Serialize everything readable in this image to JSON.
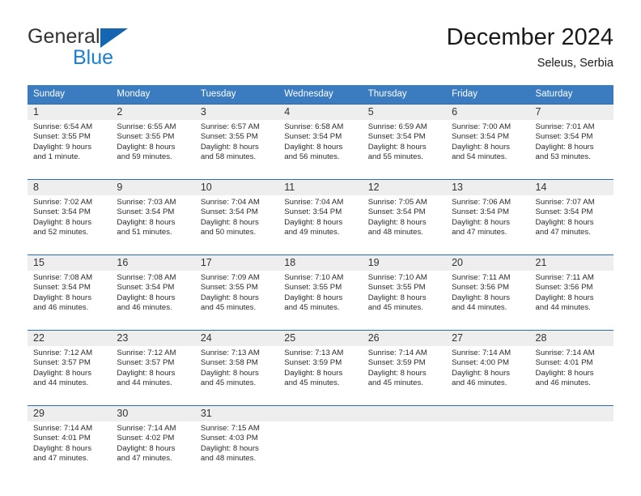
{
  "brand": {
    "name_part1": "General",
    "name_part2": "Blue",
    "logo_icon": "triangle-logo-icon"
  },
  "header": {
    "title": "December 2024",
    "subtitle": "Seleus, Serbia"
  },
  "colors": {
    "header_row_bg": "#3b7cc0",
    "cell_border": "#2c6cb0",
    "daynum_bg": "#eeeeee",
    "brand_blue": "#1a7fd4",
    "logo_blue": "#1566b0"
  },
  "weekday_headers": [
    "Sunday",
    "Monday",
    "Tuesday",
    "Wednesday",
    "Thursday",
    "Friday",
    "Saturday"
  ],
  "weeks": [
    [
      {
        "day": "1",
        "sunrise": "Sunrise: 6:54 AM",
        "sunset": "Sunset: 3:55 PM",
        "daylight1": "Daylight: 9 hours",
        "daylight2": "and 1 minute."
      },
      {
        "day": "2",
        "sunrise": "Sunrise: 6:55 AM",
        "sunset": "Sunset: 3:55 PM",
        "daylight1": "Daylight: 8 hours",
        "daylight2": "and 59 minutes."
      },
      {
        "day": "3",
        "sunrise": "Sunrise: 6:57 AM",
        "sunset": "Sunset: 3:55 PM",
        "daylight1": "Daylight: 8 hours",
        "daylight2": "and 58 minutes."
      },
      {
        "day": "4",
        "sunrise": "Sunrise: 6:58 AM",
        "sunset": "Sunset: 3:54 PM",
        "daylight1": "Daylight: 8 hours",
        "daylight2": "and 56 minutes."
      },
      {
        "day": "5",
        "sunrise": "Sunrise: 6:59 AM",
        "sunset": "Sunset: 3:54 PM",
        "daylight1": "Daylight: 8 hours",
        "daylight2": "and 55 minutes."
      },
      {
        "day": "6",
        "sunrise": "Sunrise: 7:00 AM",
        "sunset": "Sunset: 3:54 PM",
        "daylight1": "Daylight: 8 hours",
        "daylight2": "and 54 minutes."
      },
      {
        "day": "7",
        "sunrise": "Sunrise: 7:01 AM",
        "sunset": "Sunset: 3:54 PM",
        "daylight1": "Daylight: 8 hours",
        "daylight2": "and 53 minutes."
      }
    ],
    [
      {
        "day": "8",
        "sunrise": "Sunrise: 7:02 AM",
        "sunset": "Sunset: 3:54 PM",
        "daylight1": "Daylight: 8 hours",
        "daylight2": "and 52 minutes."
      },
      {
        "day": "9",
        "sunrise": "Sunrise: 7:03 AM",
        "sunset": "Sunset: 3:54 PM",
        "daylight1": "Daylight: 8 hours",
        "daylight2": "and 51 minutes."
      },
      {
        "day": "10",
        "sunrise": "Sunrise: 7:04 AM",
        "sunset": "Sunset: 3:54 PM",
        "daylight1": "Daylight: 8 hours",
        "daylight2": "and 50 minutes."
      },
      {
        "day": "11",
        "sunrise": "Sunrise: 7:04 AM",
        "sunset": "Sunset: 3:54 PM",
        "daylight1": "Daylight: 8 hours",
        "daylight2": "and 49 minutes."
      },
      {
        "day": "12",
        "sunrise": "Sunrise: 7:05 AM",
        "sunset": "Sunset: 3:54 PM",
        "daylight1": "Daylight: 8 hours",
        "daylight2": "and 48 minutes."
      },
      {
        "day": "13",
        "sunrise": "Sunrise: 7:06 AM",
        "sunset": "Sunset: 3:54 PM",
        "daylight1": "Daylight: 8 hours",
        "daylight2": "and 47 minutes."
      },
      {
        "day": "14",
        "sunrise": "Sunrise: 7:07 AM",
        "sunset": "Sunset: 3:54 PM",
        "daylight1": "Daylight: 8 hours",
        "daylight2": "and 47 minutes."
      }
    ],
    [
      {
        "day": "15",
        "sunrise": "Sunrise: 7:08 AM",
        "sunset": "Sunset: 3:54 PM",
        "daylight1": "Daylight: 8 hours",
        "daylight2": "and 46 minutes."
      },
      {
        "day": "16",
        "sunrise": "Sunrise: 7:08 AM",
        "sunset": "Sunset: 3:54 PM",
        "daylight1": "Daylight: 8 hours",
        "daylight2": "and 46 minutes."
      },
      {
        "day": "17",
        "sunrise": "Sunrise: 7:09 AM",
        "sunset": "Sunset: 3:55 PM",
        "daylight1": "Daylight: 8 hours",
        "daylight2": "and 45 minutes."
      },
      {
        "day": "18",
        "sunrise": "Sunrise: 7:10 AM",
        "sunset": "Sunset: 3:55 PM",
        "daylight1": "Daylight: 8 hours",
        "daylight2": "and 45 minutes."
      },
      {
        "day": "19",
        "sunrise": "Sunrise: 7:10 AM",
        "sunset": "Sunset: 3:55 PM",
        "daylight1": "Daylight: 8 hours",
        "daylight2": "and 45 minutes."
      },
      {
        "day": "20",
        "sunrise": "Sunrise: 7:11 AM",
        "sunset": "Sunset: 3:56 PM",
        "daylight1": "Daylight: 8 hours",
        "daylight2": "and 44 minutes."
      },
      {
        "day": "21",
        "sunrise": "Sunrise: 7:11 AM",
        "sunset": "Sunset: 3:56 PM",
        "daylight1": "Daylight: 8 hours",
        "daylight2": "and 44 minutes."
      }
    ],
    [
      {
        "day": "22",
        "sunrise": "Sunrise: 7:12 AM",
        "sunset": "Sunset: 3:57 PM",
        "daylight1": "Daylight: 8 hours",
        "daylight2": "and 44 minutes."
      },
      {
        "day": "23",
        "sunrise": "Sunrise: 7:12 AM",
        "sunset": "Sunset: 3:57 PM",
        "daylight1": "Daylight: 8 hours",
        "daylight2": "and 44 minutes."
      },
      {
        "day": "24",
        "sunrise": "Sunrise: 7:13 AM",
        "sunset": "Sunset: 3:58 PM",
        "daylight1": "Daylight: 8 hours",
        "daylight2": "and 45 minutes."
      },
      {
        "day": "25",
        "sunrise": "Sunrise: 7:13 AM",
        "sunset": "Sunset: 3:59 PM",
        "daylight1": "Daylight: 8 hours",
        "daylight2": "and 45 minutes."
      },
      {
        "day": "26",
        "sunrise": "Sunrise: 7:14 AM",
        "sunset": "Sunset: 3:59 PM",
        "daylight1": "Daylight: 8 hours",
        "daylight2": "and 45 minutes."
      },
      {
        "day": "27",
        "sunrise": "Sunrise: 7:14 AM",
        "sunset": "Sunset: 4:00 PM",
        "daylight1": "Daylight: 8 hours",
        "daylight2": "and 46 minutes."
      },
      {
        "day": "28",
        "sunrise": "Sunrise: 7:14 AM",
        "sunset": "Sunset: 4:01 PM",
        "daylight1": "Daylight: 8 hours",
        "daylight2": "and 46 minutes."
      }
    ],
    [
      {
        "day": "29",
        "sunrise": "Sunrise: 7:14 AM",
        "sunset": "Sunset: 4:01 PM",
        "daylight1": "Daylight: 8 hours",
        "daylight2": "and 47 minutes."
      },
      {
        "day": "30",
        "sunrise": "Sunrise: 7:14 AM",
        "sunset": "Sunset: 4:02 PM",
        "daylight1": "Daylight: 8 hours",
        "daylight2": "and 47 minutes."
      },
      {
        "day": "31",
        "sunrise": "Sunrise: 7:15 AM",
        "sunset": "Sunset: 4:03 PM",
        "daylight1": "Daylight: 8 hours",
        "daylight2": "and 48 minutes."
      },
      {
        "day": "",
        "sunrise": "",
        "sunset": "",
        "daylight1": "",
        "daylight2": ""
      },
      {
        "day": "",
        "sunrise": "",
        "sunset": "",
        "daylight1": "",
        "daylight2": ""
      },
      {
        "day": "",
        "sunrise": "",
        "sunset": "",
        "daylight1": "",
        "daylight2": ""
      },
      {
        "day": "",
        "sunrise": "",
        "sunset": "",
        "daylight1": "",
        "daylight2": ""
      }
    ]
  ]
}
